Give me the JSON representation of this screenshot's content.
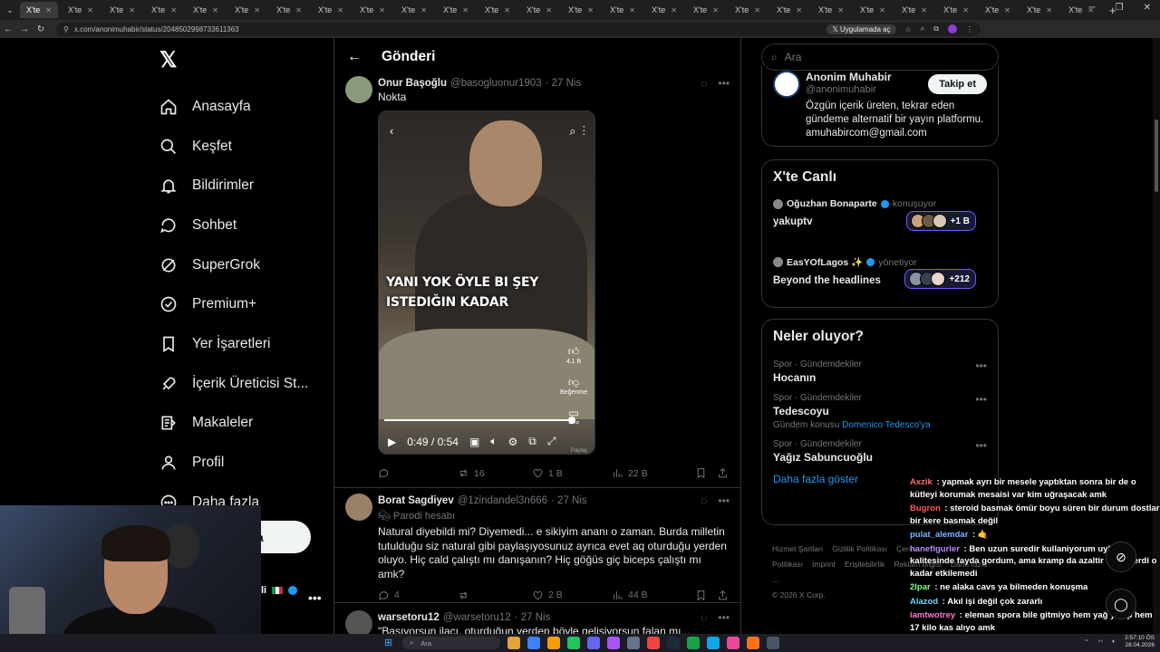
{
  "browser": {
    "tab_label": "X'te",
    "active_tab_label": "X'te",
    "url": "x.com/anonimuhabir/status/2048502998733611363",
    "install_label": "Uygulamada aç"
  },
  "sidebar": {
    "items": [
      {
        "label": "Anasayfa",
        "icon": "home-icon"
      },
      {
        "label": "Keşfet",
        "icon": "search-icon"
      },
      {
        "label": "Bildirimler",
        "icon": "bell-icon"
      },
      {
        "label": "Sohbet",
        "icon": "chat-icon"
      },
      {
        "label": "SuperGrok",
        "icon": "grok-icon"
      },
      {
        "label": "Premium+",
        "icon": "verified-icon"
      },
      {
        "label": "Yer İşaretleri",
        "icon": "bookmark-icon"
      },
      {
        "label": "İçerik Üreticisi St...",
        "icon": "rocket-icon"
      },
      {
        "label": "Makaleler",
        "icon": "article-icon"
      },
      {
        "label": "Profil",
        "icon": "person-icon"
      },
      {
        "label": "Daha fazla",
        "icon": "more-circle-icon"
      }
    ],
    "post_label": "nla",
    "account_label": "li"
  },
  "main": {
    "title": "Gönderi",
    "tweets": [
      {
        "name": "Onur Başoğlu",
        "handle": "@basogluonur1903",
        "date": "· 27 Nis",
        "text": "Nokta",
        "replies": "",
        "retweets": "16",
        "likes": "1 B",
        "views": "22 B",
        "video": {
          "caption": "YANI YOK ÖYLE BI ŞEY ISTEDIĞIN KADAR",
          "time": "0:49 / 0:54",
          "progress": 0.907,
          "likes_label": "4,1 B",
          "dislike_label": "Beğenme",
          "comments_label": "149",
          "share_label": "Paylaş"
        }
      },
      {
        "name": "Borat Sagdiyev",
        "handle": "@1zindandel3n666",
        "date": "· 27 Nis",
        "parody": "Parodi hesabı",
        "text": "Natural diyebildi mi? Diyemedi... e sikiyim ananı o zaman. Burda milletin tutulduğu siz natural gibi paylaşıyosunuz ayrıca evet aq oturduğu yerden oluyo. Hiç cald çalıştı mı danışanın? Hiç göğüs giç biceps çalıştı mı amk?",
        "replies": "4",
        "retweets": "",
        "likes": "2 B",
        "views": "44 B"
      },
      {
        "name": "warsetoru12",
        "handle": "@warsetoru12",
        "date": "· 27 Nis",
        "text": "\"Basıyorsun ilacı, oturduğun yerden böyle gelişiyorsun falan mı..."
      }
    ]
  },
  "right": {
    "search_placeholder": "Ara",
    "profile": {
      "name": "Anonim Muhabir",
      "handle": "@anonimuhabir",
      "bio": "Özgün içerik üreten, tekrar eden gündeme alternatif bir yayın platformu. amuhabircom@gmail.com",
      "follow_label": "Takip et"
    },
    "live": {
      "title": "X'te Canlı",
      "items": [
        {
          "host": "Oğuzhan Bonaparte",
          "status": "konuşuyor",
          "name": "yakuptv",
          "count": "+1 B"
        },
        {
          "host": "EasYOfLagos ✨",
          "status": "yönetiyor",
          "name": "Beyond the headlines",
          "count": "+212"
        }
      ]
    },
    "trends": {
      "title": "Neler oluyor?",
      "items": [
        {
          "category": "Spor · Gündemdekiler",
          "name": "Hocanın",
          "sub_prefix": "",
          "sub_link": ""
        },
        {
          "category": "Spor · Gündemdekiler",
          "name": "Tedescoyu",
          "sub_prefix": "Gündem konusu",
          "sub_link": "Domenico Tedesco'ya"
        },
        {
          "category": "Spor · Gündemdekiler",
          "name": "Yağız Sabuncuoğlu",
          "sub_prefix": "",
          "sub_link": ""
        }
      ],
      "show_more": "Daha fazla göster"
    },
    "footer": {
      "links": [
        "Hizmet Şartları",
        "Gizlilik Politikası",
        "Çerez Politikası",
        "Imprint",
        "Erişilebilirlik",
        "Reklam bilgisi",
        "Daha fazla ..."
      ],
      "copyright": "© 2026 X Corp."
    }
  },
  "chat": [
    {
      "user": "Axzik",
      "color": "#ff6b6b",
      "text": "yapmak ayrı bir mesele yaptıktan sonra bir de o kütleyi korumak mesaisi var kim uğraşacak amk"
    },
    {
      "user": "Bugron",
      "color": "#ff5a5a",
      "text": "steroid basmak ömür boyu süren bir durum dostlar bir kere basmak değil"
    },
    {
      "user": "pulat_alemdar",
      "color": "#7ab8ff",
      "text": "🤙"
    },
    {
      "user": "hanefigurler",
      "color": "#b98cff",
      "text": "Ben uzun suredir kullaniyorum uyku kalitesinde fayda gordum, ama kramp da azaltir demislerdi o kadar etkilemedi"
    },
    {
      "user": "2lpar",
      "color": "#7dff8a",
      "text": "ne alaka cavs ya bilmeden konuşma"
    },
    {
      "user": "Alazod",
      "color": "#6bd5ff",
      "text": "Akıl işi değil çok zararlı"
    },
    {
      "user": "iamtwotrey",
      "color": "#ff7ad0",
      "text": "eleman spora bile gitmiyo hem yağ yakıp hem 17 kilo kas alıyo amk"
    }
  ],
  "taskbar": {
    "search_placeholder": "Ara",
    "time": "2:57:10 ÖS",
    "date": "28.04.2026"
  },
  "colors": {
    "accent": "#1d9bf0",
    "live_border": "#7856ff",
    "background": "#000000"
  }
}
